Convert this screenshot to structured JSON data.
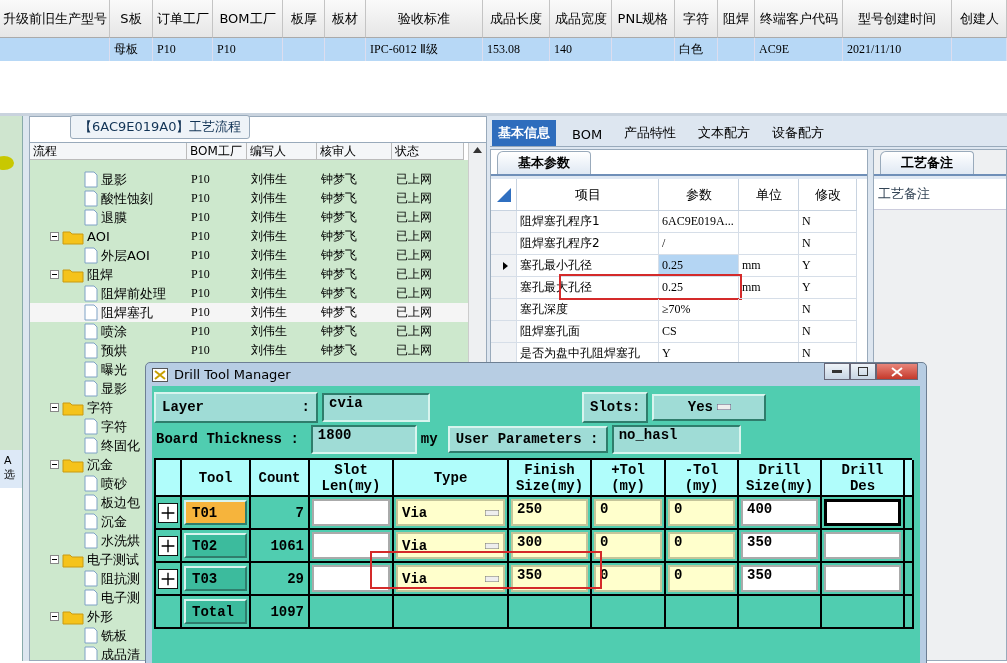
{
  "header_table": {
    "columns": [
      "升级前旧生产型号",
      "S板",
      "订单工厂",
      "BOM工厂",
      "板厚",
      "板材",
      "验收标准",
      "成品长度",
      "成品宽度",
      "PNL规格",
      "字符",
      "阻焊",
      "终端客户代码",
      "型号创建时间",
      "创建人"
    ],
    "rows": [
      {
        "selected": true,
        "cells": [
          "",
          "母板",
          "P10",
          "P10",
          "",
          "",
          "IPC-6012 Ⅱ级",
          "153.08",
          "140",
          "",
          "白色",
          "",
          "AC9E",
          "2021/11/10",
          ""
        ]
      }
    ]
  },
  "left_strip": {
    "labels": [
      "A",
      "选"
    ]
  },
  "process_panel": {
    "title": "【6AC9E019A0】工艺流程",
    "columns": [
      "流程",
      "BOM工厂",
      "编写人",
      "核审人",
      "状态"
    ],
    "tree": [
      {
        "children": [
          {
            "label": "显影",
            "bom": "P10",
            "writer": "刘伟生",
            "reviewer": "钟梦飞",
            "status": "已上网",
            "selected": false
          },
          {
            "label": "酸性蚀刻",
            "bom": "P10",
            "writer": "刘伟生",
            "reviewer": "钟梦飞",
            "status": "已上网",
            "selected": false
          },
          {
            "label": "退膜",
            "bom": "P10",
            "writer": "刘伟生",
            "reviewer": "钟梦飞",
            "status": "已上网",
            "selected": false
          }
        ]
      },
      {
        "label": "AOI",
        "bom": "P10",
        "writer": "刘伟生",
        "reviewer": "钟梦飞",
        "status": "已上网",
        "selected": false,
        "expanded": true,
        "children": [
          {
            "label": "外层AOI",
            "bom": "P10",
            "writer": "刘伟生",
            "reviewer": "钟梦飞",
            "status": "已上网",
            "selected": false
          }
        ]
      },
      {
        "label": "阻焊",
        "bom": "P10",
        "writer": "刘伟生",
        "reviewer": "钟梦飞",
        "status": "已上网",
        "selected": false,
        "expanded": true,
        "children": [
          {
            "label": "阻焊前处理",
            "bom": "P10",
            "writer": "刘伟生",
            "reviewer": "钟梦飞",
            "status": "已上网",
            "selected": false
          },
          {
            "label": "阻焊塞孔",
            "bom": "P10",
            "writer": "刘伟生",
            "reviewer": "钟梦飞",
            "status": "已上网",
            "selected": true
          },
          {
            "label": "喷涂",
            "bom": "P10",
            "writer": "刘伟生",
            "reviewer": "钟梦飞",
            "status": "已上网",
            "selected": false
          },
          {
            "label": "预烘",
            "bom": "P10",
            "writer": "刘伟生",
            "reviewer": "钟梦飞",
            "status": "已上网",
            "selected": false
          },
          {
            "label": "曝光",
            "selected": false
          },
          {
            "label": "显影",
            "selected": false
          }
        ]
      },
      {
        "label": "字符",
        "selected": false,
        "expanded": true,
        "children": [
          {
            "label": "字符",
            "selected": false
          },
          {
            "label": "终固化",
            "selected": false
          }
        ]
      },
      {
        "label": "沉金",
        "selected": false,
        "expanded": true,
        "children": [
          {
            "label": "喷砂",
            "selected": false
          },
          {
            "label": "板边包",
            "selected": false
          },
          {
            "label": "沉金",
            "selected": false
          },
          {
            "label": "水洗烘",
            "selected": false
          }
        ]
      },
      {
        "label": "电子测试",
        "selected": false,
        "expanded": true,
        "children": [
          {
            "label": "阻抗测",
            "selected": false
          },
          {
            "label": "电子测",
            "selected": false
          }
        ]
      },
      {
        "label": "外形",
        "selected": false,
        "expanded": true,
        "children": [
          {
            "label": "铣板",
            "selected": false
          },
          {
            "label": "成品清",
            "selected": false
          }
        ]
      }
    ]
  },
  "detail_tabs": [
    {
      "label": "基本信息",
      "selected": true
    },
    {
      "label": "BOM",
      "selected": false
    },
    {
      "label": "产品特性",
      "selected": false
    },
    {
      "label": "文本配方",
      "selected": false
    },
    {
      "label": "设备配方",
      "selected": false
    }
  ],
  "basic_params": {
    "tab": "基本参数",
    "columns": [
      "项目",
      "参数",
      "单位",
      "修改"
    ],
    "rows": [
      {
        "item": "阻焊塞孔程序1",
        "value": "6AC9E019A...",
        "modified": "N",
        "selected": false
      },
      {
        "item": "阻焊塞孔程序2",
        "value": "/",
        "modified": "N",
        "selected": false
      },
      {
        "item": "塞孔最小孔径",
        "value": "0.25",
        "unit": "mm",
        "modified": "Y",
        "selected": true
      },
      {
        "item": "塞孔最大孔径",
        "value": "0.25",
        "unit": "mm",
        "modified": "Y",
        "selected": false,
        "outlined": true
      },
      {
        "item": "塞孔深度",
        "value": "≥70%",
        "modified": "N",
        "selected": false
      },
      {
        "item": "阻焊塞孔面",
        "value": "CS",
        "modified": "N",
        "selected": false
      },
      {
        "item": "是否为盘中孔阻焊塞孔",
        "value": "Y",
        "modified": "N",
        "selected": false
      }
    ]
  },
  "notes_panel": {
    "tab": "工艺备注",
    "label": "工艺备注"
  },
  "drill_dialog": {
    "title": "Drill Tool Manager",
    "layer": {
      "label": "Layer",
      "colon": ":",
      "value": "cvia"
    },
    "slots": {
      "label": "Slots:",
      "value": "Yes"
    },
    "thickness": {
      "label": "Board Thickness :",
      "value": "1800",
      "unit": "my"
    },
    "user_params": {
      "label": "User Parameters :",
      "value": "no_hasl"
    },
    "columns": [
      "Tool",
      "Count",
      "Slot\nLen(my)",
      "Type",
      "Finish\nSize(my)",
      "+Tol\n(my)",
      "-Tol\n(my)",
      "Drill\nSize(my)",
      "Drill\nDes"
    ],
    "rows": [
      {
        "kind": "tool",
        "tool": "T01",
        "selected": true,
        "count": "7",
        "type": "Via",
        "finish": "250",
        "plus_tol": "0",
        "minus_tol": "0",
        "drill_size": "400",
        "focused": true
      },
      {
        "kind": "tool",
        "tool": "T02",
        "selected": false,
        "count": "1061",
        "type": "Via",
        "finish": "300",
        "plus_tol": "0",
        "minus_tol": "0",
        "drill_size": "350",
        "focused": false
      },
      {
        "kind": "tool",
        "tool": "T03",
        "selected": false,
        "count": "29",
        "type": "Via",
        "finish": "350",
        "plus_tol": "0",
        "minus_tol": "0",
        "drill_size": "350",
        "focused": false,
        "outlined": true
      },
      {
        "kind": "total",
        "tool": "Total",
        "count": "1097"
      }
    ]
  }
}
